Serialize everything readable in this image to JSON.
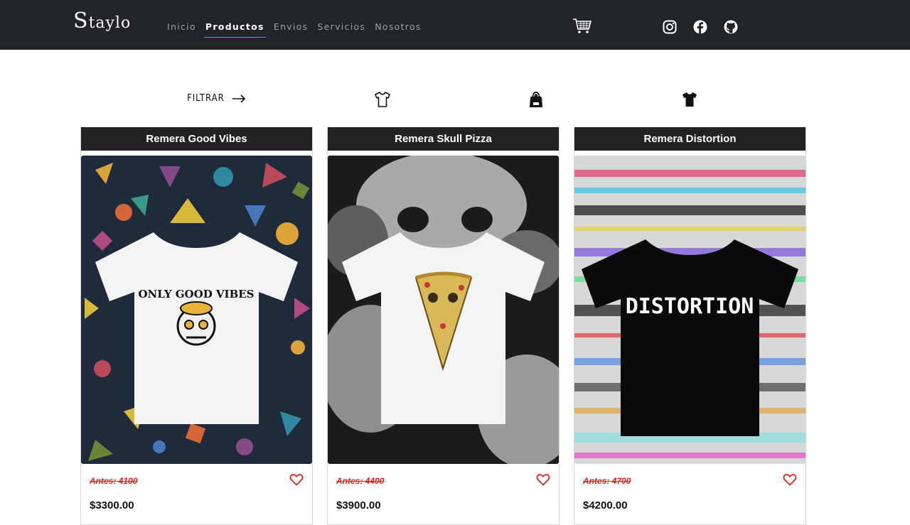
{
  "brand": {
    "name": "Staylo",
    "first": "S",
    "rest": "taylo"
  },
  "nav": [
    "Inicio",
    "Productos",
    "Envios",
    "Servicios",
    "Nosotros"
  ],
  "active_nav": "Productos",
  "filter": {
    "label": "FILTRAR"
  },
  "products": [
    {
      "title": "Remera Good Vibes",
      "old_price": "Antes: 4100",
      "price": "$3300.00",
      "shirt_color": "#ffffff",
      "print": "ONLY GOOD VIBES"
    },
    {
      "title": "Remera Skull Pizza",
      "old_price": "Antes: 4400",
      "price": "$3900.00",
      "shirt_color": "#ffffff",
      "print": ""
    },
    {
      "title": "Remera Distortion",
      "old_price": "Antes: 4700",
      "price": "$4200.00",
      "shirt_color": "#0a0a0a",
      "print": "DISTORTION"
    }
  ],
  "icons": [
    "cart-icon",
    "instagram-icon",
    "facebook-icon",
    "github-icon",
    "arrow-right-icon",
    "tshirt-outline-icon",
    "hoodie-icon",
    "tshirt-filled-icon",
    "heart-icon"
  ],
  "colors": {
    "navbar": "#212429",
    "accent": "#3aa0ff",
    "old_price": "#e02020",
    "card_header": "#222222"
  }
}
